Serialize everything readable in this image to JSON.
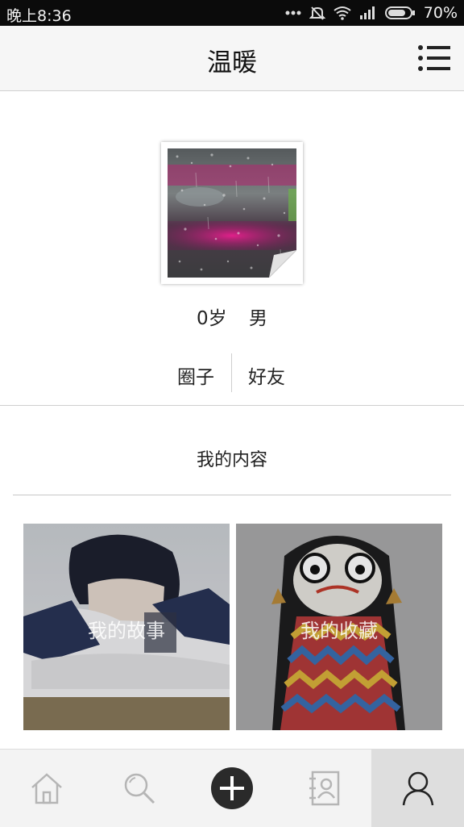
{
  "status_bar": {
    "time": "晚上8:36",
    "battery": "70%",
    "icons": [
      "more-dots-icon",
      "silent-icon",
      "wifi-icon",
      "signal-icon",
      "battery-icon"
    ]
  },
  "header": {
    "title": "温暖",
    "menu_icon": "menu-list-icon"
  },
  "profile": {
    "age": "0岁",
    "gender": "男",
    "avatar_icon": "rainy-window-avatar"
  },
  "links": {
    "circle": "圈子",
    "friends": "好友"
  },
  "content": {
    "title": "我的内容",
    "cards": [
      {
        "label": "我的故事",
        "image": "sleeping-girl-photo"
      },
      {
        "label": "我的收藏",
        "image": "cartoon-girl-illustration"
      }
    ]
  },
  "tabbar": {
    "tabs": [
      "home-icon",
      "search-icon",
      "add-icon",
      "contacts-icon",
      "profile-icon"
    ],
    "active_index": 4
  },
  "colors": {
    "statusbar": "#0b0b0b",
    "header_bg": "#f6f6f6",
    "tabbar_bg": "#f3f3f3",
    "active_tab": "#dedede",
    "divider": "#cfcfcf"
  }
}
